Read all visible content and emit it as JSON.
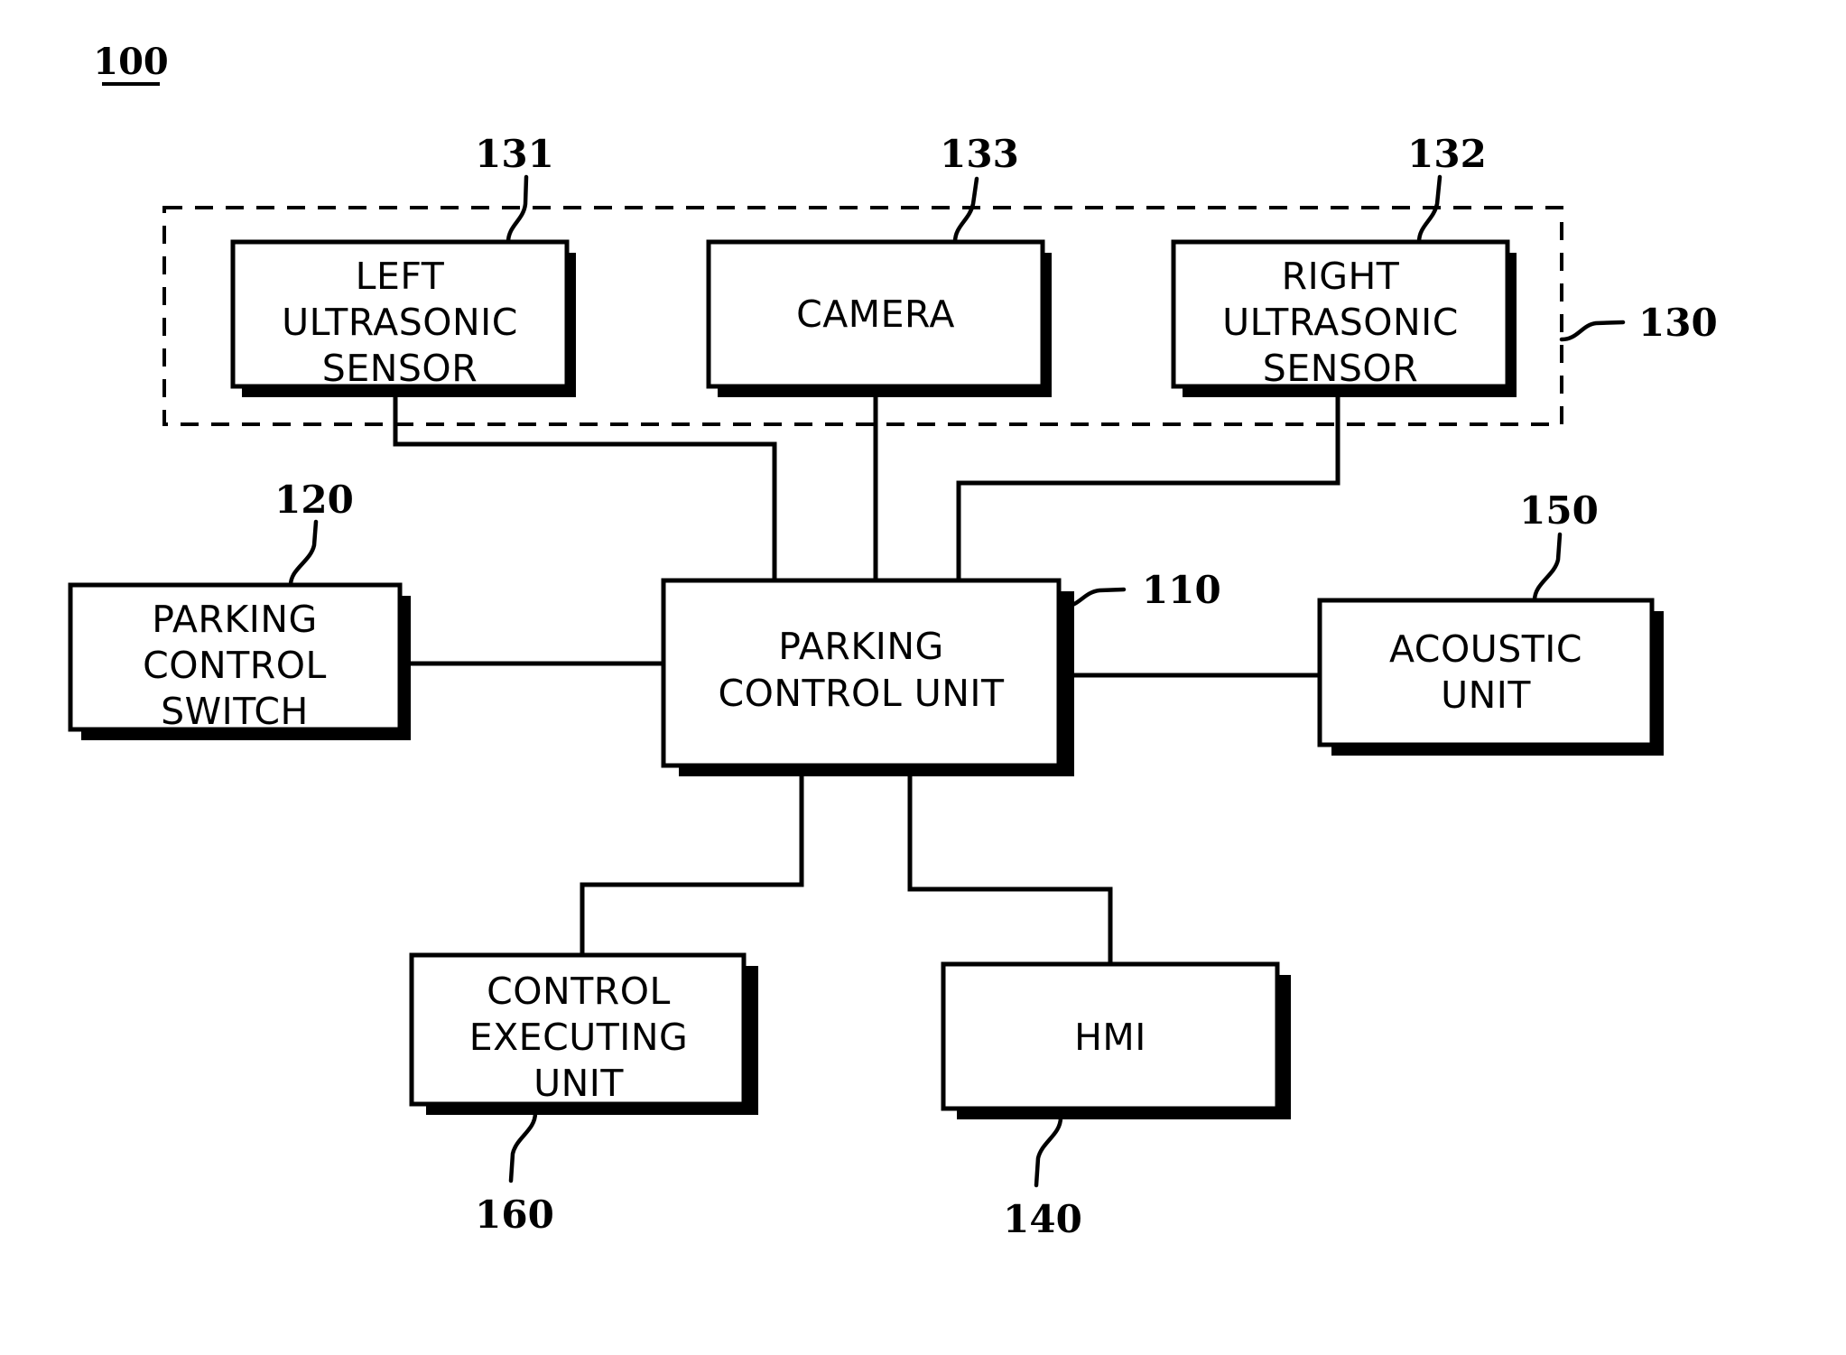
{
  "figure": {
    "number": "100",
    "number_underlined": true
  },
  "groups": [
    {
      "id": "sensor-group",
      "ref": "130",
      "style": "dashed"
    }
  ],
  "blocks": [
    {
      "id": "left-ultrasonic-sensor",
      "ref": "131",
      "lines": [
        "LEFT",
        "ULTRASONIC",
        "SENSOR"
      ],
      "text": "LEFT ULTRASONIC SENSOR"
    },
    {
      "id": "camera",
      "ref": "133",
      "lines": [
        "CAMERA"
      ],
      "text": "CAMERA"
    },
    {
      "id": "right-ultrasonic-sensor",
      "ref": "132",
      "lines": [
        "RIGHT",
        "ULTRASONIC",
        "SENSOR"
      ],
      "text": "RIGHT ULTRASONIC SENSOR"
    },
    {
      "id": "parking-control-switch",
      "ref": "120",
      "lines": [
        "PARKING",
        "CONTROL",
        "SWITCH"
      ],
      "text": "PARKING CONTROL SWITCH"
    },
    {
      "id": "parking-control-unit",
      "ref": "110",
      "lines": [
        "PARKING",
        "CONTROL UNIT"
      ],
      "text": "PARKING CONTROL UNIT"
    },
    {
      "id": "acoustic-unit",
      "ref": "150",
      "lines": [
        "ACOUSTIC",
        "UNIT"
      ],
      "text": "ACOUSTIC UNIT"
    },
    {
      "id": "control-executing-unit",
      "ref": "160",
      "lines": [
        "CONTROL",
        "EXECUTING",
        "UNIT"
      ],
      "text": "CONTROL EXECUTING UNIT"
    },
    {
      "id": "hmi",
      "ref": "140",
      "lines": [
        "HMI"
      ],
      "text": "HMI"
    }
  ],
  "labels": {
    "left_ultrasonic_l1": "LEFT",
    "left_ultrasonic_l2": "ULTRASONIC",
    "left_ultrasonic_l3": "SENSOR",
    "camera_l1": "CAMERA",
    "right_ultrasonic_l1": "RIGHT",
    "right_ultrasonic_l2": "ULTRASONIC",
    "right_ultrasonic_l3": "SENSOR",
    "parking_switch_l1": "PARKING",
    "parking_switch_l2": "CONTROL",
    "parking_switch_l3": "SWITCH",
    "pcu_l1": "PARKING",
    "pcu_l2": "CONTROL UNIT",
    "acoustic_l1": "ACOUSTIC",
    "acoustic_l2": "UNIT",
    "ceu_l1": "CONTROL",
    "ceu_l2": "EXECUTING",
    "ceu_l3": "UNIT",
    "hmi_l1": "HMI"
  },
  "refs": {
    "figure": "100",
    "sensor_group": "130",
    "left_ultrasonic": "131",
    "right_ultrasonic": "132",
    "camera": "133",
    "parking_switch": "120",
    "parking_control_unit": "110",
    "acoustic_unit": "150",
    "control_executing_unit": "160",
    "hmi": "140"
  },
  "colors": {
    "stroke": "#000000",
    "fill": "#ffffff",
    "shadow": "#000000"
  }
}
